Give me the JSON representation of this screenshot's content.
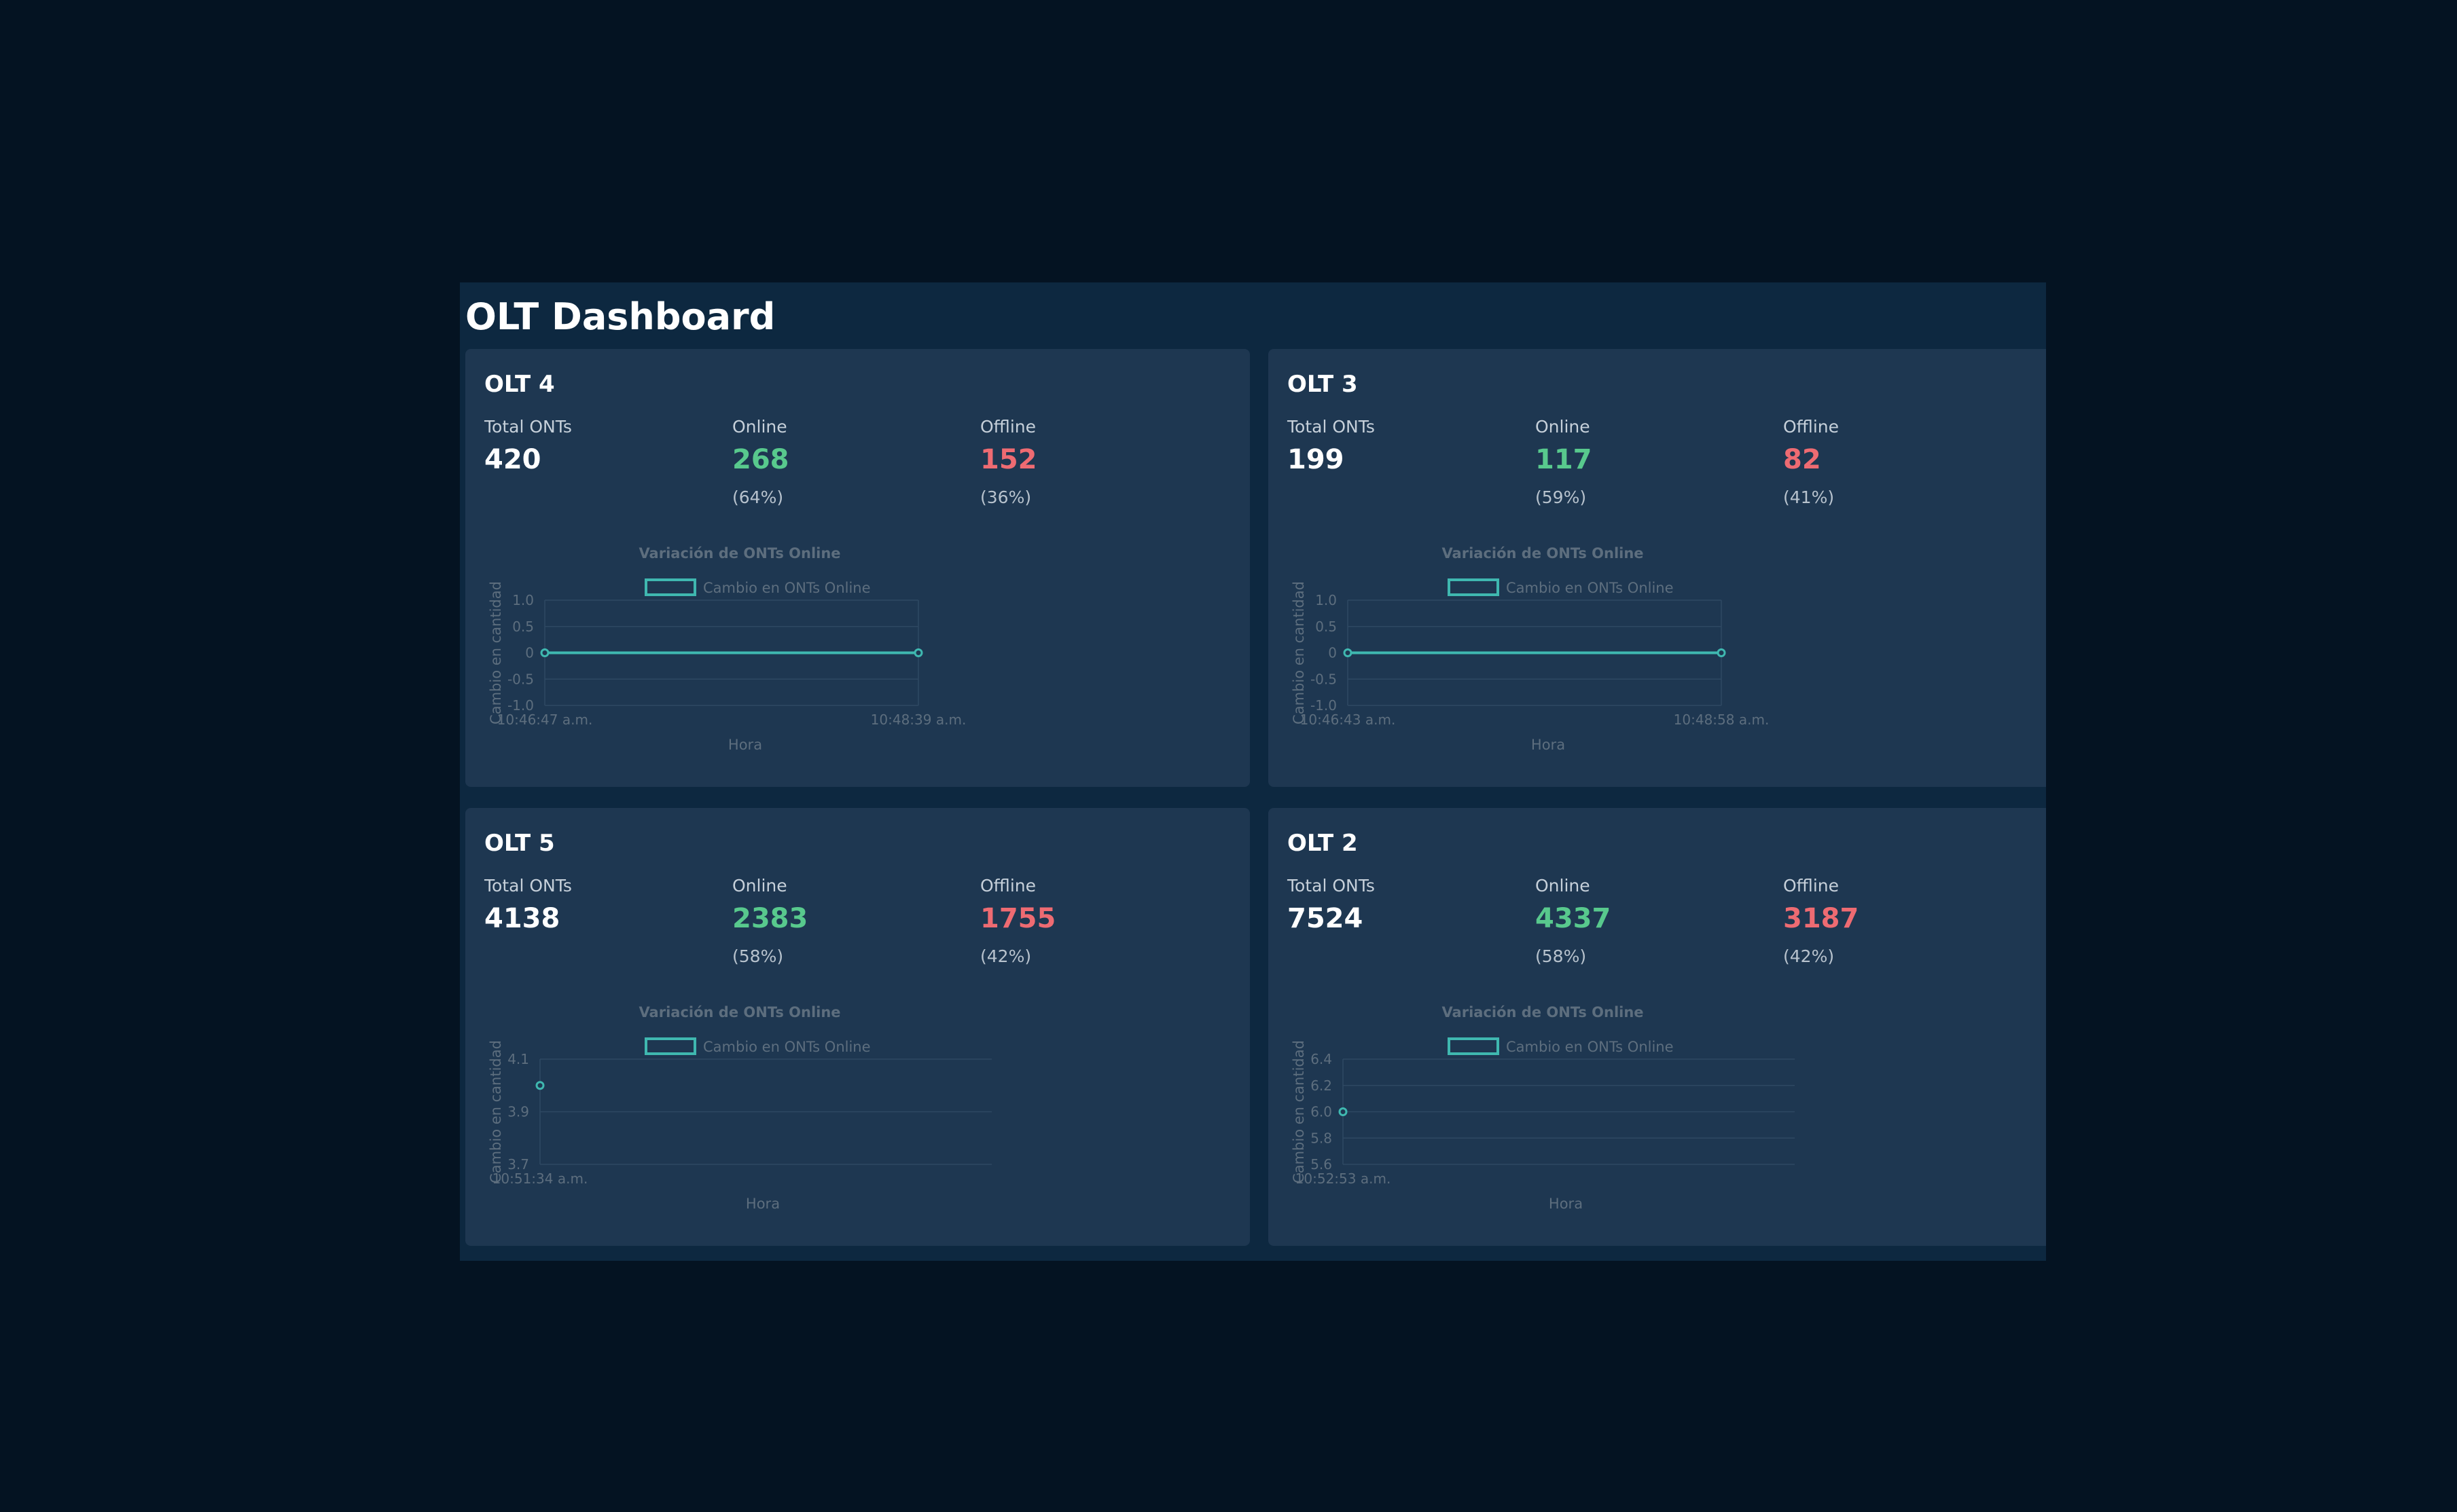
{
  "dashboard": {
    "title": "OLT Dashboard"
  },
  "colors": {
    "background": "#041322",
    "panel": "#0d2840",
    "card": "#1e3751",
    "online": "#58c98d",
    "offline": "#ee6b72",
    "series": "#3fb8b0"
  },
  "cards": [
    {
      "title": "OLT 4",
      "total": {
        "label": "Total ONTs",
        "value": "420"
      },
      "online": {
        "label": "Online",
        "value": "268",
        "pct": "(64%)"
      },
      "offline": {
        "label": "Offline",
        "value": "152",
        "pct": "(36%)"
      }
    },
    {
      "title": "OLT 3",
      "total": {
        "label": "Total ONTs",
        "value": "199"
      },
      "online": {
        "label": "Online",
        "value": "117",
        "pct": "(59%)"
      },
      "offline": {
        "label": "Offline",
        "value": "82",
        "pct": "(41%)"
      }
    },
    {
      "title": "OLT 5",
      "total": {
        "label": "Total ONTs",
        "value": "4138"
      },
      "online": {
        "label": "Online",
        "value": "2383",
        "pct": "(58%)"
      },
      "offline": {
        "label": "Offline",
        "value": "1755",
        "pct": "(42%)"
      }
    },
    {
      "title": "OLT 2",
      "total": {
        "label": "Total ONTs",
        "value": "7524"
      },
      "online": {
        "label": "Online",
        "value": "4337",
        "pct": "(58%)"
      },
      "offline": {
        "label": "Offline",
        "value": "3187",
        "pct": "(42%)"
      }
    }
  ],
  "chart_data": [
    {
      "type": "line",
      "title": "Variación de ONTs Online",
      "xlabel": "Hora",
      "ylabel": "Cambio en cantidad",
      "x": [
        "10:46:47 a.m.",
        "10:48:39 a.m."
      ],
      "series": [
        {
          "name": "Cambio en ONTs Online",
          "values": [
            0,
            0
          ]
        }
      ],
      "ylim": [
        -1,
        1
      ],
      "yticks": [
        1,
        0.5,
        0,
        -0.5,
        -1
      ],
      "ytick_labels": [
        "1.0",
        "0.5",
        "0",
        "-0.5",
        "-1.0"
      ],
      "grid": true,
      "legend": "top"
    },
    {
      "type": "line",
      "title": "Variación de ONTs Online",
      "xlabel": "Hora",
      "ylabel": "Cambio en cantidad",
      "x": [
        "10:46:43 a.m.",
        "10:48:58 a.m."
      ],
      "series": [
        {
          "name": "Cambio en ONTs Online",
          "values": [
            0,
            0
          ]
        }
      ],
      "ylim": [
        -1,
        1
      ],
      "yticks": [
        1,
        0.5,
        0,
        -0.5,
        -1
      ],
      "ytick_labels": [
        "1.0",
        "0.5",
        "0",
        "-0.5",
        "-1.0"
      ],
      "grid": true,
      "legend": "top"
    },
    {
      "type": "line",
      "title": "Variación de ONTs Online",
      "xlabel": "Hora",
      "ylabel": "Cambio en cantidad",
      "x": [
        "10:51:34 a.m."
      ],
      "series": [
        {
          "name": "Cambio en ONTs Online",
          "values": [
            4
          ]
        }
      ],
      "ylim": [
        3.7,
        4.1
      ],
      "yticks": [
        4.1,
        3.9,
        3.7
      ],
      "ytick_labels": [
        "4.1",
        "3.9",
        "3.7"
      ],
      "grid": true,
      "legend": "top"
    },
    {
      "type": "line",
      "title": "Variación de ONTs Online",
      "xlabel": "Hora",
      "ylabel": "Cambio en cantidad",
      "x": [
        "10:52:53 a.m."
      ],
      "series": [
        {
          "name": "Cambio en ONTs Online",
          "values": [
            6
          ]
        }
      ],
      "ylim": [
        5.6,
        6.4
      ],
      "yticks": [
        6.4,
        6.2,
        6.0,
        5.8,
        5.6
      ],
      "ytick_labels": [
        "6.4",
        "6.2",
        "6.0",
        "5.8",
        "5.6"
      ],
      "grid": true,
      "legend": "top"
    }
  ]
}
